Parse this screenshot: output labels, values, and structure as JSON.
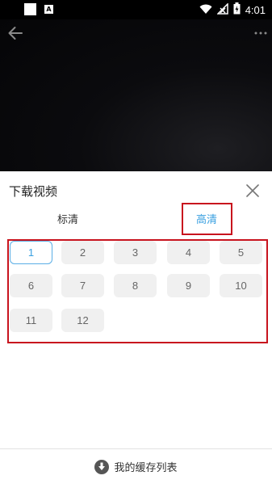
{
  "status_bar": {
    "time": "4:01",
    "icons": [
      "app-square-icon",
      "a-badge-icon",
      "wifi-icon",
      "signal-icon",
      "battery-icon"
    ],
    "a_badge": "A"
  },
  "video": {
    "back_icon": "arrow-left-icon",
    "more_icon": "more-dots-icon"
  },
  "panel": {
    "title": "下载视频",
    "close_icon": "close-icon",
    "tabs": [
      {
        "label": "标清",
        "active": false
      },
      {
        "label": "高清",
        "active": true
      }
    ],
    "episodes": [
      "1",
      "2",
      "3",
      "4",
      "5",
      "6",
      "7",
      "8",
      "9",
      "10",
      "11",
      "12"
    ],
    "selected_episode": "1",
    "cache_label": "我的缓存列表",
    "cache_icon": "download-circle-icon"
  },
  "colors": {
    "accent": "#3aa0e0",
    "highlight_box": "#c8141e",
    "episode_bg": "#f0f0f0"
  }
}
